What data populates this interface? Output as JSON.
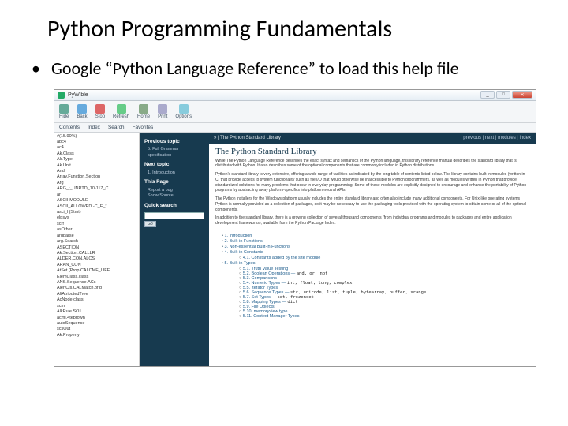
{
  "slide": {
    "title": "Python Programming Fundamentals",
    "bullet": "Google “Python Language Reference” to load this help file"
  },
  "app": {
    "title": "PyWible",
    "winbtns": {
      "min": "_",
      "max": "□",
      "close": "✕"
    },
    "toolbar": [
      {
        "label": "Hide",
        "color": "#6a9"
      },
      {
        "label": "Back",
        "color": "#6ad"
      },
      {
        "label": "Stop",
        "color": "#d66"
      },
      {
        "label": "Refresh",
        "color": "#6c8"
      },
      {
        "label": "Home",
        "color": "#8a8"
      },
      {
        "label": "Print",
        "color": "#aac"
      },
      {
        "label": "Options",
        "color": "#8cd"
      }
    ],
    "menubar": [
      "Contents",
      "Index",
      "Search",
      "Favorites"
    ],
    "leftlist": [
      "#(15.90%)",
      "abc4",
      "ac4",
      "Ak.Class",
      "Ak.Type",
      "Ak.Unit",
      "And",
      "Array.Function.Section",
      "Arg",
      "ARG_t_UNRTD_10-117_C",
      "ar",
      "ASCII-MODULE",
      "ASCII_ALLOWED -C_E_*",
      "asci_l (Stmt)",
      "elpsys",
      "scrf",
      "asOther",
      "argparse",
      "arg.Search",
      "ASECTION",
      "Ak.Section.CALLLR",
      "ALDER.CON.ALCS",
      "ARAN_CON",
      "AtSet.(Prop.CALCMF_LIFE",
      "ElemClass.class",
      "ANS.Sequence.ACs",
      "AlertCls.CALMatch.ofIb",
      "AltAtributedTree",
      "AcNode.class",
      "scmi",
      "AlkRule.SO1",
      "acmi.4tebrown",
      "autoSequence",
      "scsOut",
      "Ak.Property"
    ],
    "sidebar": {
      "prev_h": "Previous topic",
      "prev_l1": "5. Full Grammar",
      "prev_l2": "specification",
      "next_h": "Next topic",
      "next_l1": "1. Introduction",
      "this_h": "This Page",
      "this_l1": "Report a bug",
      "this_l2": "Show Source",
      "search_h": "Quick search",
      "go": "Go"
    },
    "content": {
      "breadcrumb": "» | The Python Standard Library",
      "nav": "previous | next | modules | index",
      "title": "The Python Standard Library",
      "p1": "While The Python Language Reference describes the exact syntax and semantics of the Python language, this library reference manual describes the standard library that is distributed with Python. It also describes some of the optional components that are commonly included in Python distributions.",
      "p2": "Python's standard library is very extensive, offering a wide range of facilities as indicated by the long table of contents listed below. The library contains built-in modules (written in C) that provide access to system functionality such as file I/O that would otherwise be inaccessible to Python programmers, as well as modules written in Python that provide standardized solutions for many problems that occur in everyday programming. Some of these modules are explicitly designed to encourage and enhance the portability of Python programs by abstracting away platform-specifics into platform-neutral APIs.",
      "p3": "The Python installers for the Windows platform usually includes the entire standard library and often also include many additional components. For Unix-like operating systems Python is normally provided as a collection of packages, so it may be necessary to use the packaging tools provided with the operating system to obtain some or all of the optional components.",
      "p4": "In addition to the standard library, there is a growing collection of several thousand components (from individual programs and modules to packages and entire application development frameworks), available from the Python Package Index.",
      "toc": [
        {
          "l": 1,
          "t": "1. Introduction"
        },
        {
          "l": 1,
          "t": "2. Built-in Functions"
        },
        {
          "l": 1,
          "t": "3. Non-essential Built-in Functions"
        },
        {
          "l": 1,
          "t": "4. Built-in Constants"
        },
        {
          "l": 2,
          "t": "4.1. Constants added by the site module"
        },
        {
          "l": 1,
          "t": "5. Built-in Types"
        },
        {
          "l": 2,
          "t": "5.1. Truth Value Testing"
        },
        {
          "l": 2,
          "t": "5.2. Boolean Operations — ",
          "c": "and, or, not"
        },
        {
          "l": 2,
          "t": "5.3. Comparisons"
        },
        {
          "l": 2,
          "t": "5.4. Numeric Types — ",
          "c": "int, float, long, complex"
        },
        {
          "l": 2,
          "t": "5.5. Iterator Types"
        },
        {
          "l": 2,
          "t": "5.6. Sequence Types — ",
          "c": "str, unicode, list, tuple, bytearray, buffer, xrange"
        },
        {
          "l": 2,
          "t": "5.7. Set Types — ",
          "c": "set, frozenset"
        },
        {
          "l": 2,
          "t": "5.8. Mapping Types — ",
          "c": "dict"
        },
        {
          "l": 2,
          "t": "5.9. File Objects"
        },
        {
          "l": 2,
          "t": "5.10. memoryview type"
        },
        {
          "l": 2,
          "t": "5.11. Context Manager Types"
        }
      ]
    }
  }
}
